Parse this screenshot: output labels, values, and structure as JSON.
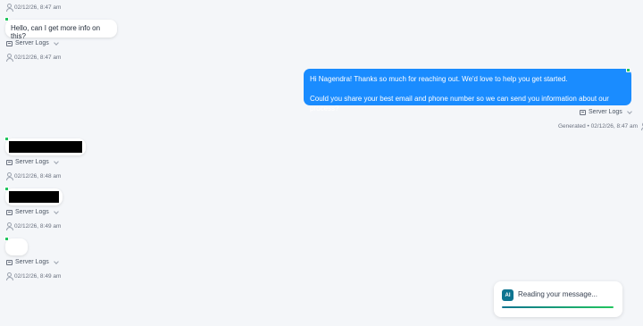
{
  "messages": {
    "m0": {
      "timestamp": "02/12/26, 8:47 am"
    },
    "m1": {
      "text": "Hello, can I get more info on this?",
      "logs_label": "Server Logs",
      "timestamp": "02/12/26, 8:47 am"
    },
    "m2": {
      "line1": "Hi Nagendra! Thanks so much for reaching out. We'd love to help you get started.",
      "line2": "Could you share your best email and phone number so we can send you information about our process?",
      "logs_label": "Server Logs",
      "generated": "Generated • 02/12/26, 8:47 am"
    },
    "m3": {
      "logs_label": "Server Logs",
      "timestamp": "02/12/26, 8:48 am"
    },
    "m4": {
      "logs_label": "Server Logs",
      "timestamp": "02/12/26, 8:49 am"
    },
    "m5": {
      "logs_label": "Server Logs",
      "timestamp": "02/12/26, 8:49 am"
    }
  },
  "status": {
    "badge": "AI",
    "text": "Reading your message...",
    "progress": 1.0,
    "colors": {
      "start": "#0e7490",
      "end": "#22c55e"
    }
  },
  "colors": {
    "outgoing_bubble": "#1a8cff",
    "background": "#f4f6f9",
    "online_indicator": "#22c55e"
  }
}
